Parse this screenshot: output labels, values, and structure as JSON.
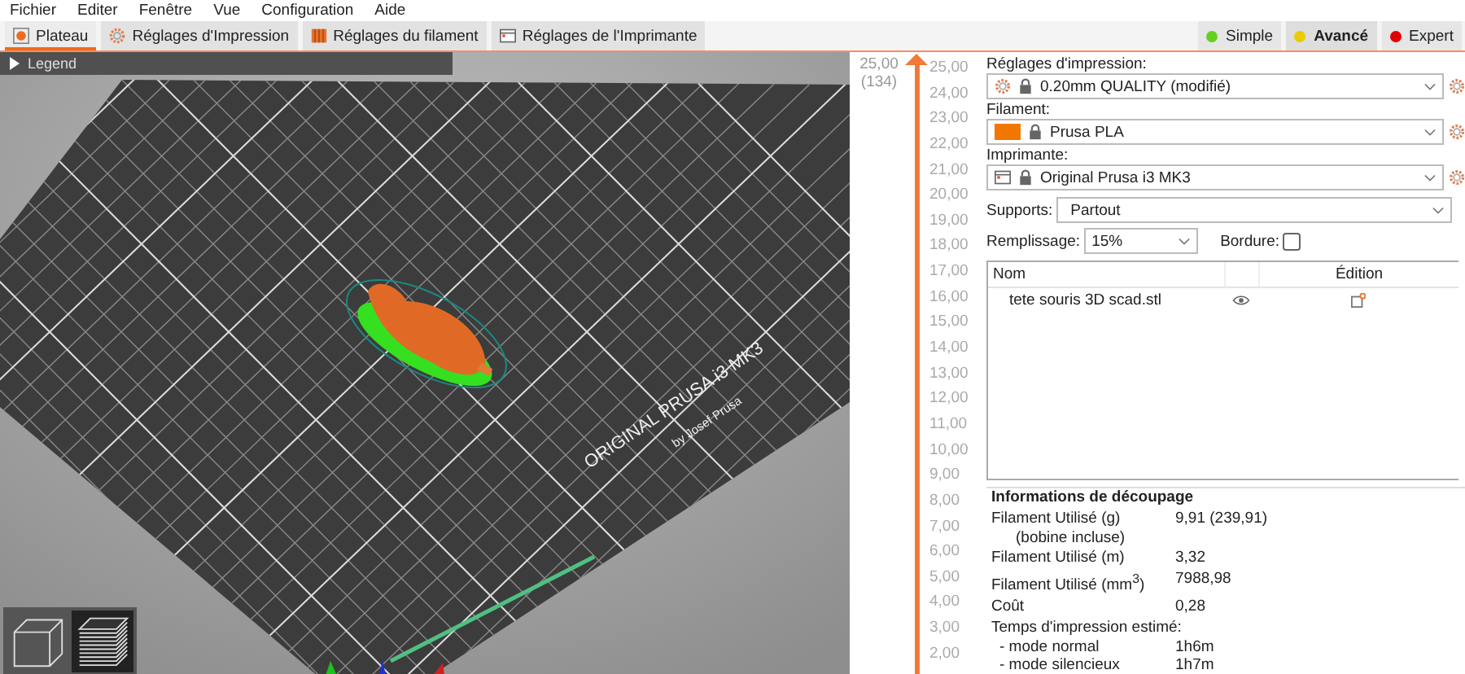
{
  "menu": [
    "Fichier",
    "Editer",
    "Fenêtre",
    "Vue",
    "Configuration",
    "Aide"
  ],
  "tabs": [
    {
      "label": "Plateau",
      "kind": "plater",
      "selected": true
    },
    {
      "label": "Réglages d'Impression",
      "kind": "print",
      "selected": false
    },
    {
      "label": "Réglages du filament",
      "kind": "filament",
      "selected": false
    },
    {
      "label": "Réglages de l'Imprimante",
      "kind": "printer",
      "selected": false
    }
  ],
  "modes": [
    {
      "label": "Simple",
      "color": "#66d022",
      "selected": false
    },
    {
      "label": "Avancé",
      "color": "#e8cc00",
      "selected": true
    },
    {
      "label": "Expert",
      "color": "#e00000",
      "selected": false
    }
  ],
  "viewport": {
    "legend": "Legend",
    "bed_label": "ORIGINAL PRUSA i3 MK3",
    "bed_sublabel": "by Josef Prusa",
    "view_buttons": [
      {
        "kind": "iso",
        "selected": false
      },
      {
        "kind": "layers",
        "selected": true
      }
    ]
  },
  "layer_slider": {
    "top_value": "25,00",
    "top_layer": "(134)",
    "level": 1,
    "ticks": [
      "25,00",
      "24,00",
      "23,00",
      "22,00",
      "21,00",
      "20,00",
      "19,00",
      "18,00",
      "17,00",
      "16,00",
      "15,00",
      "14,00",
      "13,00",
      "12,00",
      "11,00",
      "10,00",
      "9,00",
      "8,00",
      "7,00",
      "6,00",
      "5,00",
      "4,00",
      "3,00",
      "2,00"
    ]
  },
  "sidebar": {
    "presets": [
      {
        "label": "Réglages d'impression:",
        "value": "0.20mm QUALITY (modifié)",
        "kind": "print"
      },
      {
        "label": "Filament:",
        "value": "Prusa PLA",
        "kind": "filament"
      },
      {
        "label": "Imprimante:",
        "value": "Original Prusa i3 MK3",
        "kind": "printer"
      }
    ],
    "supports": {
      "label": "Supports:",
      "value": "Partout"
    },
    "infill": {
      "label": "Remplissage:",
      "value": "15%"
    },
    "brim": {
      "label": "Bordure:",
      "checked": false
    },
    "objects": {
      "columns": [
        "Nom",
        "Édition"
      ],
      "rows": [
        {
          "name": "tete souris 3D scad.stl"
        }
      ]
    },
    "slice_info": {
      "title": "Informations de découpage",
      "rows": [
        {
          "kind": "pair",
          "label": "Filament Utilisé (g)",
          "value": "9,91 (239,91)"
        },
        {
          "kind": "note",
          "label": "(bobine incluse)"
        },
        {
          "kind": "pair",
          "label": "Filament Utilisé (m)",
          "value": "3,32"
        },
        {
          "kind": "pair",
          "label": "Filament Utilisé (mm$^{3}$)",
          "value": "7988,98"
        },
        {
          "kind": "pair",
          "label": "Coût",
          "value": "0,28"
        },
        {
          "kind": "heading",
          "label": "Temps d'impression estimé:"
        },
        {
          "kind": "sub",
          "label": "- mode normal",
          "value": "1h6m"
        },
        {
          "kind": "sub",
          "label": "- mode silencieux",
          "value": "1h7m"
        }
      ]
    }
  }
}
